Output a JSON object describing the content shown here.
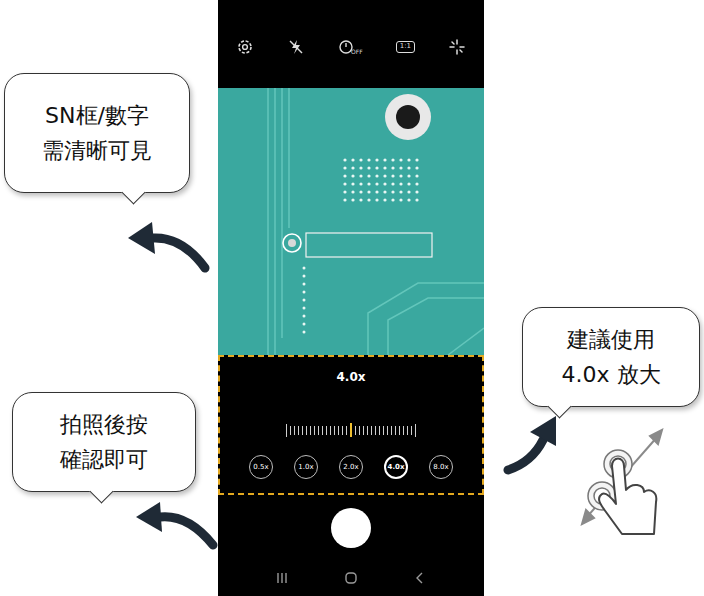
{
  "camera": {
    "top_bar": {
      "timer_label": "OFF",
      "ratio_label": "1:1"
    },
    "zoom": {
      "reading": "4.0x",
      "options": [
        {
          "label": "0.5x",
          "selected": false
        },
        {
          "label": "1.0x",
          "selected": false
        },
        {
          "label": "2.0x",
          "selected": false
        },
        {
          "label": "4.0x",
          "selected": true
        },
        {
          "label": "8.0x",
          "selected": false
        }
      ]
    }
  },
  "callouts": [
    {
      "lines": [
        "SN框/數字",
        "需清晰可見"
      ]
    },
    {
      "lines": [
        "拍照後按",
        "確認即可"
      ]
    },
    {
      "lines": [
        "建議使用",
        "4.0x 放大"
      ]
    }
  ]
}
